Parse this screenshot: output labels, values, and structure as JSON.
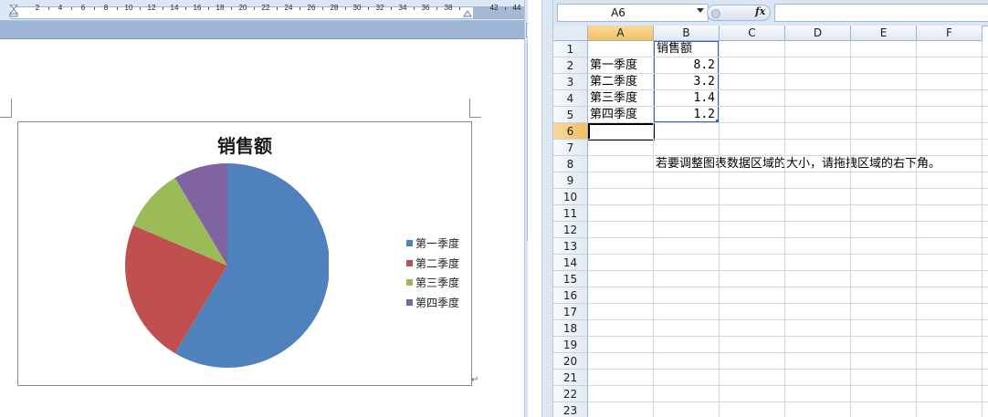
{
  "word": {
    "ruler_labels": [
      "2",
      "4",
      "6",
      "8",
      "10",
      "12",
      "14",
      "16",
      "18",
      "20",
      "22",
      "24",
      "26",
      "28",
      "30",
      "32",
      "34",
      "36",
      "38",
      "42",
      "44"
    ],
    "paragraph_mark": "↵",
    "split_icon": "split-window-icon"
  },
  "chart_data": {
    "type": "pie",
    "title": "销售额",
    "categories": [
      "第一季度",
      "第二季度",
      "第三季度",
      "第四季度"
    ],
    "values": [
      8.2,
      3.2,
      1.4,
      1.2
    ],
    "colors": [
      "#4f81bd",
      "#c0504d",
      "#9bbb59",
      "#8064a2"
    ],
    "legend_position": "right"
  },
  "excel": {
    "name_box": "A6",
    "fx_label": "fx",
    "formula": "",
    "columns": [
      "A",
      "B",
      "C",
      "D",
      "E",
      "F"
    ],
    "rows": [
      "1",
      "2",
      "3",
      "4",
      "5",
      "6",
      "7",
      "8",
      "9",
      "10",
      "11",
      "12",
      "13",
      "14",
      "15",
      "16",
      "17",
      "18",
      "19",
      "20",
      "21",
      "22",
      "23"
    ],
    "active_column": "A",
    "active_row": "6",
    "cells": {
      "b1": "销售额",
      "a2": "第一季度",
      "b2": "8.2",
      "a3": "第二季度",
      "b3": "3.2",
      "a4": "第三季度",
      "b4": "1.4",
      "a5": "第四季度",
      "b5": "1.2",
      "b8": "若要调整图表数据区域的大小，请拖拽区域的右下角。"
    }
  }
}
